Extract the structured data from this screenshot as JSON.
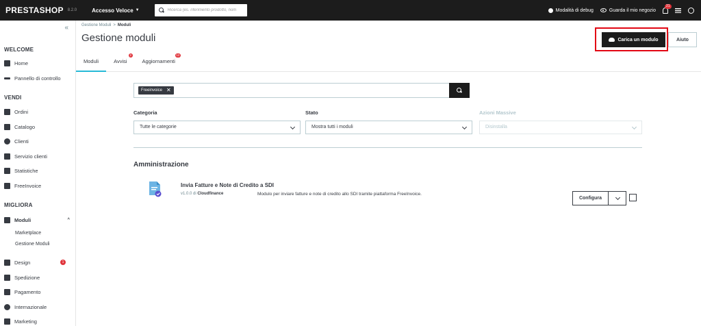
{
  "topbar": {
    "logo": "PRESTASHOP",
    "version": "8.2.0",
    "quick_access": "Accesso Veloce",
    "search_placeholder": "Ricerca (es. riferimento prodotto, nom",
    "debug_label": "Modalità di debug",
    "view_shop_label": "Guarda il mio negozio",
    "notifications_count": "21"
  },
  "sidebar": {
    "sections": [
      {
        "title": "WELCOME"
      },
      {
        "title": "VENDI"
      },
      {
        "title": "MIGLIORA"
      }
    ],
    "welcome_items": [
      "Home",
      "Pannello di controllo"
    ],
    "vendi_items": [
      "Ordini",
      "Catalogo",
      "Clienti",
      "Servizio clienti",
      "Statistiche",
      "FreeInvoice"
    ],
    "migliora_items": [
      {
        "label": "Moduli"
      },
      {
        "label": "Design",
        "badge": "1"
      },
      {
        "label": "Spedizione"
      },
      {
        "label": "Pagamento"
      },
      {
        "label": "Internazionale"
      },
      {
        "label": "Marketing"
      }
    ],
    "moduli_sub": [
      "Marketplace",
      "Gestione Moduli"
    ]
  },
  "header": {
    "breadcrumb": [
      "Gestione Moduli",
      "Moduli"
    ],
    "breadcrumb_sep": ">",
    "title": "Gestione moduli",
    "upload_label": "Carica un modulo",
    "help_label": "Aiuto",
    "tabs": [
      {
        "label": "Moduli",
        "badge": ""
      },
      {
        "label": "Avvisi",
        "badge": "2"
      },
      {
        "label": "Aggiornamenti",
        "badge": "12"
      }
    ]
  },
  "filters": {
    "search_chip": "Freeinvoice",
    "category_label": "Categoria",
    "category_value": "Tutte le categorie",
    "status_label": "Stato",
    "status_value": "Mostra tutti i moduli",
    "bulk_label": "Azioni Massive",
    "bulk_value": "Disinstalla"
  },
  "category_title": "Amministrazione",
  "module": {
    "name": "Invia Fatture e Note di Credito a SDI",
    "version_prefix": "v1.0.0 di",
    "author": "Cloudfinance",
    "description": "Modulo per inviare fatture e note di credito allo SDI tramite piattaforma FreeInvoice.",
    "configure_label": "Configura"
  },
  "colors": {
    "topbar": "#1c1c1c",
    "accent": "#25b9d7",
    "highlight": "#e20613",
    "badge": "#e0343b"
  }
}
